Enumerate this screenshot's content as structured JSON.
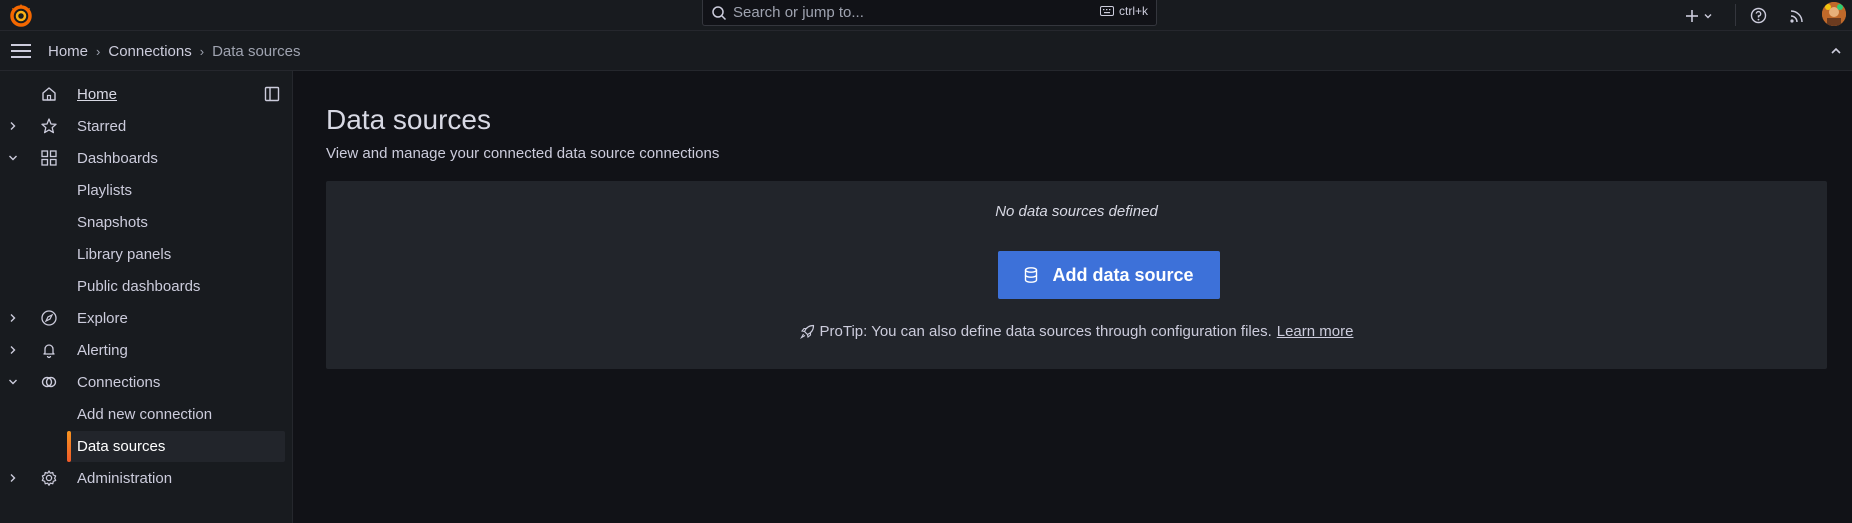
{
  "topbar": {
    "search_placeholder": "Search or jump to...",
    "search_shortcut": "ctrl+k",
    "icons": [
      "grafana-logo-icon",
      "search-icon",
      "keyboard-icon",
      "plus-icon",
      "chevron-down-icon",
      "help-icon",
      "rss-icon",
      "avatar"
    ]
  },
  "breadcrumb": {
    "items": [
      "Home",
      "Connections",
      "Data sources"
    ]
  },
  "sidebar": {
    "items": [
      {
        "label": "Home",
        "icon": "home-icon"
      },
      {
        "label": "Starred",
        "icon": "star-icon",
        "expand": "collapsed"
      },
      {
        "label": "Dashboards",
        "icon": "apps-icon",
        "expand": "expanded"
      },
      {
        "label": "Playlists"
      },
      {
        "label": "Snapshots"
      },
      {
        "label": "Library panels"
      },
      {
        "label": "Public dashboards"
      },
      {
        "label": "Explore",
        "icon": "compass-icon",
        "expand": "collapsed"
      },
      {
        "label": "Alerting",
        "icon": "bell-icon",
        "expand": "collapsed"
      },
      {
        "label": "Connections",
        "icon": "connections-icon",
        "expand": "expanded"
      },
      {
        "label": "Add new connection"
      },
      {
        "label": "Data sources",
        "active": true
      },
      {
        "label": "Administration",
        "icon": "cog-icon",
        "expand": "collapsed"
      }
    ]
  },
  "main": {
    "title": "Data sources",
    "subtitle": "View and manage your connected data source connections",
    "empty_message": "No data sources defined",
    "add_button": "Add data source",
    "protip_text": "ProTip: You can also define data sources through configuration files.",
    "protip_link": "Learn more"
  },
  "colors": {
    "accent_blue": "#3d71d9",
    "active_marker": "#f05a28",
    "background": "#111217",
    "panel": "#181b1f"
  }
}
